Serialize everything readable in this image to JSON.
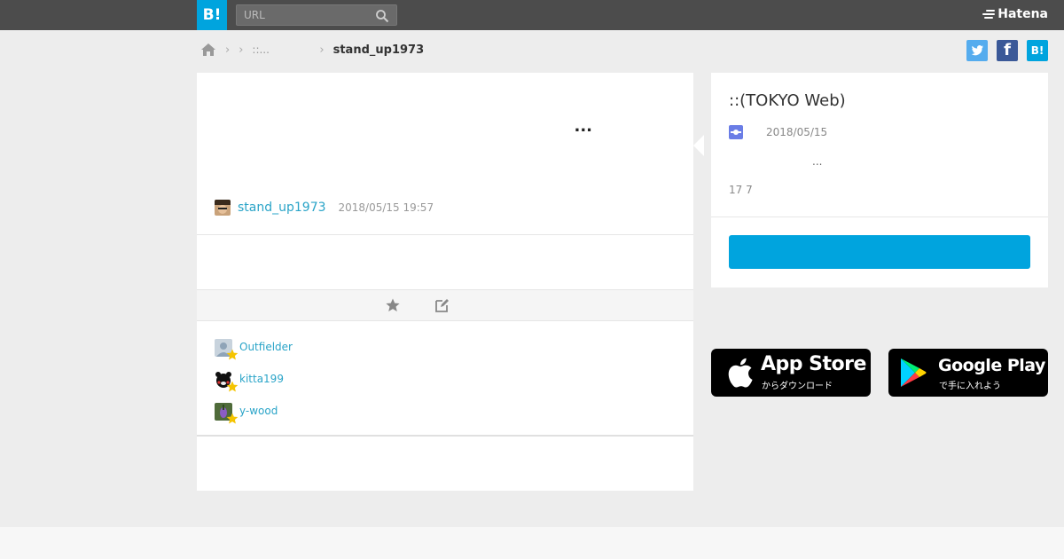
{
  "header": {
    "logo_label": "B!",
    "search_placeholder": "URL",
    "brand": "Hatena"
  },
  "breadcrumb": {
    "middle": "::...",
    "current": "stand_up1973"
  },
  "share": {
    "twitter_label": "",
    "facebook_label": "f",
    "hatena_label": "B!"
  },
  "comment": {
    "text": "...",
    "user": "stand_up1973",
    "timestamp": "2018/05/15 19:57"
  },
  "stars": [
    {
      "user": "Outfielder"
    },
    {
      "user": "kitta199"
    },
    {
      "user": "y-wood"
    }
  ],
  "entry": {
    "title": "::(TOKYO Web)",
    "date": "2018/05/15",
    "excerpt": "...",
    "counts": "17 7"
  },
  "stores": {
    "apple_big": "App Store",
    "apple_small": "からダウンロード",
    "google_big": "Google Play",
    "google_small": "で手に入れよう"
  },
  "colors": {
    "accent": "#00a4de",
    "header_bg": "#4c4c4c",
    "link": "#2aa4c8",
    "twitter": "#55acee",
    "facebook": "#3b5998",
    "star": "#f5c400"
  }
}
